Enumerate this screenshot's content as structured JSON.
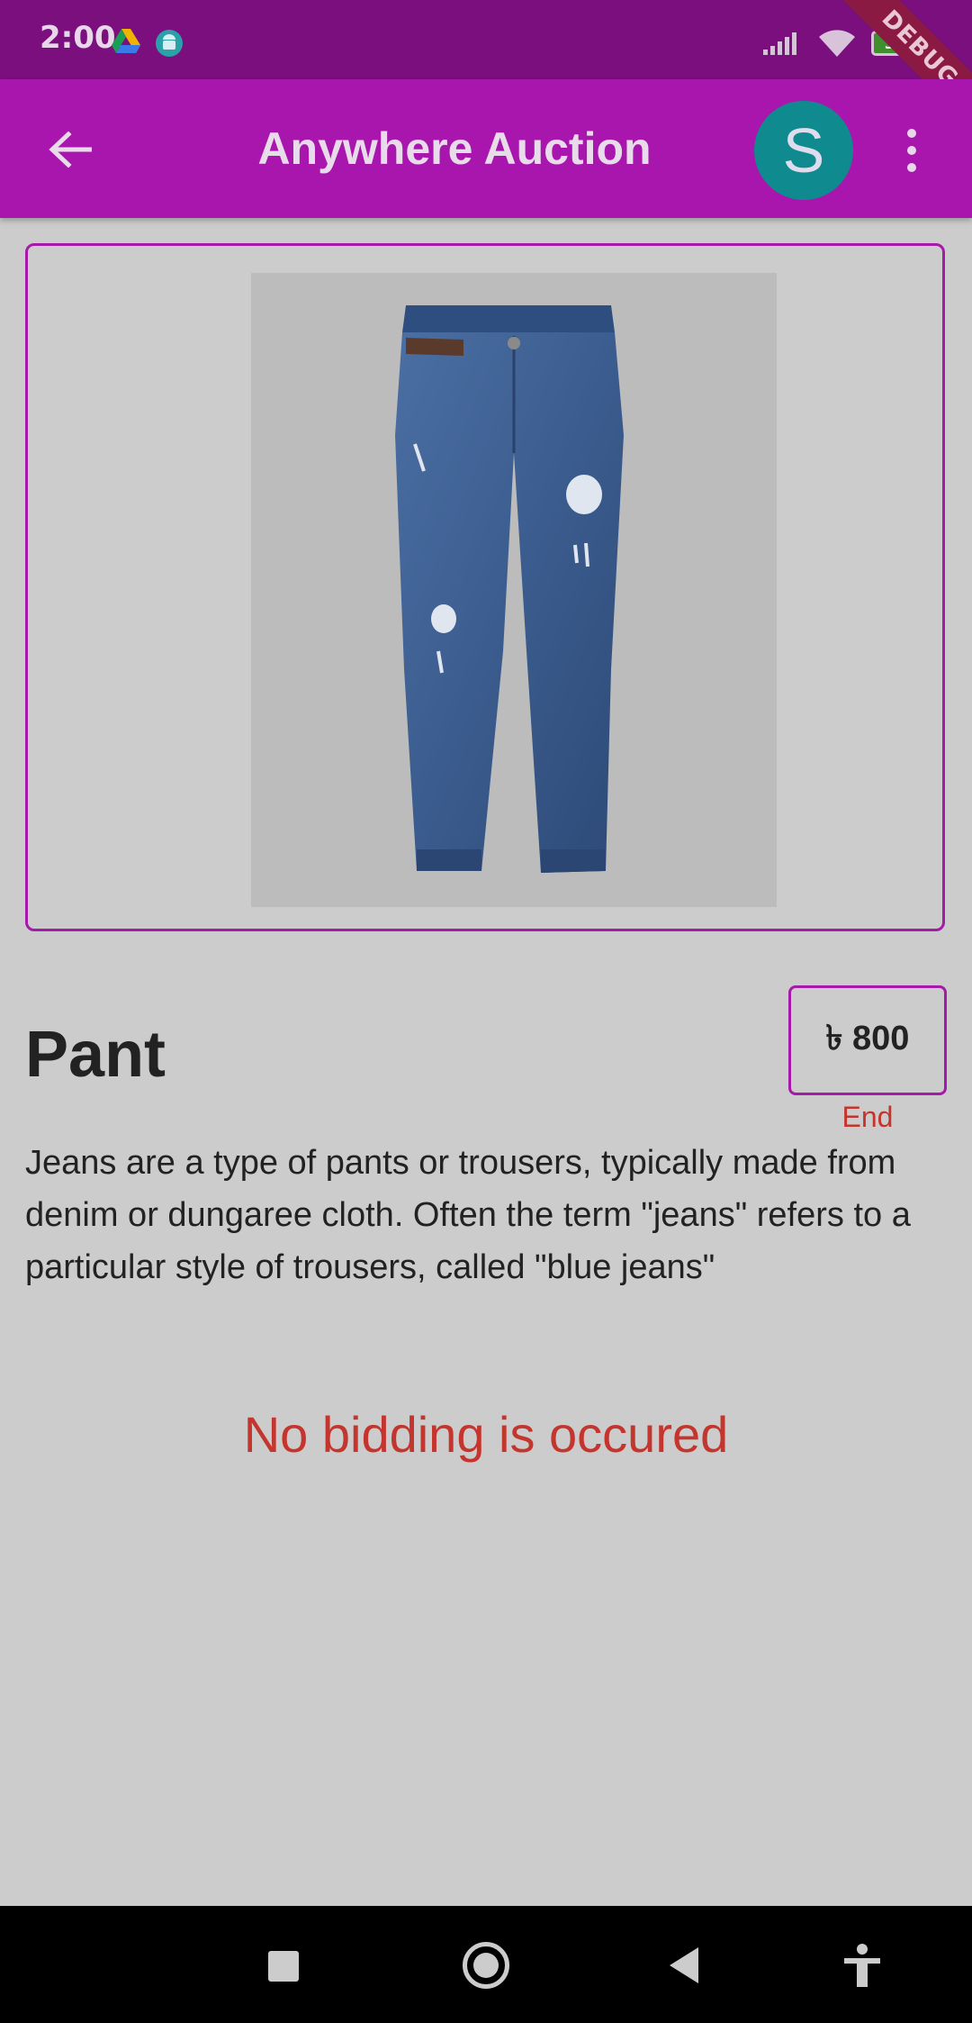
{
  "status_bar": {
    "time": "2:00",
    "battery": "34",
    "debug_label": "DEBUG"
  },
  "app_bar": {
    "title": "Anywhere Auction",
    "avatar_letter": "S",
    "color": "#a816ae"
  },
  "product": {
    "name": "Pant",
    "price": "৳ 800",
    "status": "End",
    "description": "Jeans are a type of pants or trousers, typically made from denim or dungaree cloth. Often the term \"jeans\" refers to a particular style of trousers, called \"blue jeans\"",
    "image_icon": "jeans-product-image"
  },
  "bidding": {
    "message": "No bidding is occured"
  },
  "colors": {
    "accent": "#a51aa8",
    "alert": "#c4352d"
  }
}
